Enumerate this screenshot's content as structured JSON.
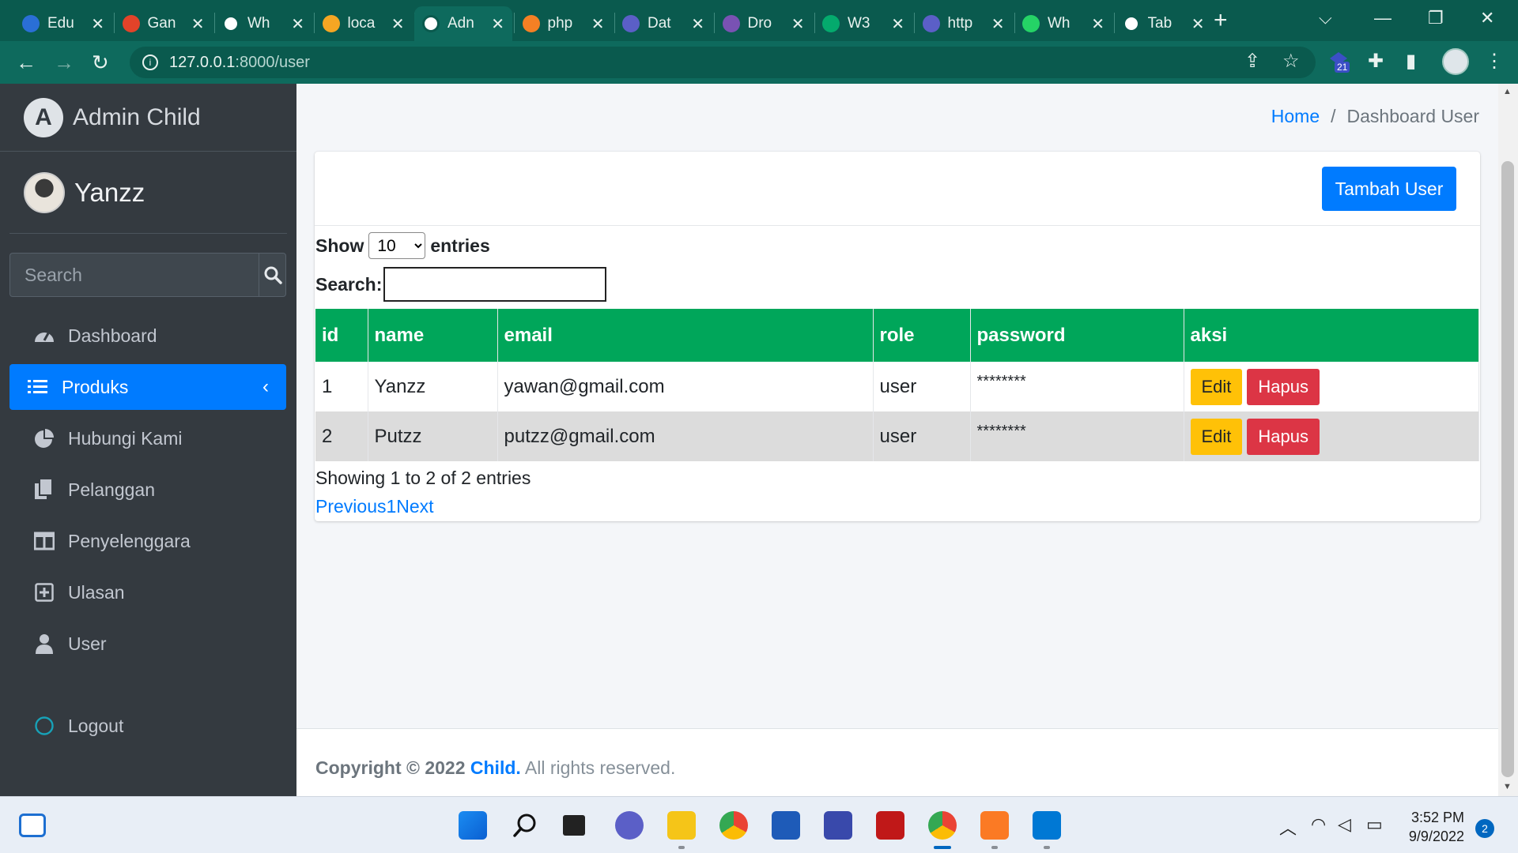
{
  "browser": {
    "tabs": [
      {
        "title": "Edu",
        "icon": "graduate-icon",
        "color": "#2a6fd6"
      },
      {
        "title": "Gan",
        "icon": "gitlab-icon",
        "color": "#e24329"
      },
      {
        "title": "Wh",
        "icon": "globe-icon",
        "color": "#ffffff"
      },
      {
        "title": "loca",
        "icon": "xampp-icon",
        "color": "#f5a623"
      },
      {
        "title": "Adn",
        "icon": "globe-icon",
        "color": "#ffffff"
      },
      {
        "title": "php",
        "icon": "stackoverflow-icon",
        "color": "#f48024"
      },
      {
        "title": "Dat",
        "icon": "orb-icon",
        "color": "#5b5fc7"
      },
      {
        "title": "Dro",
        "icon": "bootstrap-icon",
        "color": "#7952b3"
      },
      {
        "title": "W3",
        "icon": "w3schools-icon",
        "color": "#04aa6d"
      },
      {
        "title": "http",
        "icon": "orb-icon",
        "color": "#5b5fc7"
      },
      {
        "title": "Wh",
        "icon": "whatsapp-icon",
        "color": "#25d366"
      },
      {
        "title": "Tab",
        "icon": "chrome-icon",
        "color": "#ffffff"
      }
    ],
    "active_tab_index": 4,
    "url_host": "127.0.0.1",
    "url_rest": ":8000/user",
    "extension_badge": "21"
  },
  "sidebar": {
    "brand": "Admin Child",
    "brand_logo_letter": "A",
    "user_name": "Yanzz",
    "search_placeholder": "Search",
    "items": [
      {
        "label": "Dashboard",
        "icon": "dashboard-gauge-icon"
      },
      {
        "label": "Produks",
        "icon": "list-icon",
        "active": true
      },
      {
        "label": "Hubungi Kami",
        "icon": "pie-chart-icon"
      },
      {
        "label": "Pelanggan",
        "icon": "copy-icon"
      },
      {
        "label": "Penyelenggara",
        "icon": "columns-icon"
      },
      {
        "label": "Ulasan",
        "icon": "plus-square-icon"
      },
      {
        "label": "User",
        "icon": "user-icon"
      }
    ],
    "logout_label": "Logout"
  },
  "breadcrumb": {
    "home": "Home",
    "separator": "/",
    "current": "Dashboard User"
  },
  "card": {
    "add_button": "Tambah User",
    "show_label": "Show",
    "entries_label": "entries",
    "length_value": "10",
    "search_label": "Search:",
    "search_value": ""
  },
  "table": {
    "headers": [
      "id",
      "name",
      "email",
      "role",
      "password",
      "aksi"
    ],
    "rows": [
      {
        "id": "1",
        "name": "Yanzz",
        "email": "yawan@gmail.com",
        "role": "user",
        "password": "********"
      },
      {
        "id": "2",
        "name": "Putzz",
        "email": "putzz@gmail.com",
        "role": "user",
        "password": "********"
      }
    ],
    "edit_label": "Edit",
    "delete_label": "Hapus",
    "header_color": "#00a65a"
  },
  "pagination": {
    "info": "Showing 1 to 2 of 2 entries",
    "previous": "Previous",
    "page": "1",
    "next": "Next"
  },
  "footer": {
    "copyright": "Copyright © 2022",
    "brand": "Child.",
    "rights": "All rights reserved."
  },
  "taskbar": {
    "time": "3:52 PM",
    "date": "9/9/2022",
    "notifications": "2"
  },
  "colors": {
    "primary": "#007bff",
    "sidebar": "#343a40",
    "success": "#00a65a",
    "warning": "#ffc107",
    "danger": "#dc3545"
  }
}
